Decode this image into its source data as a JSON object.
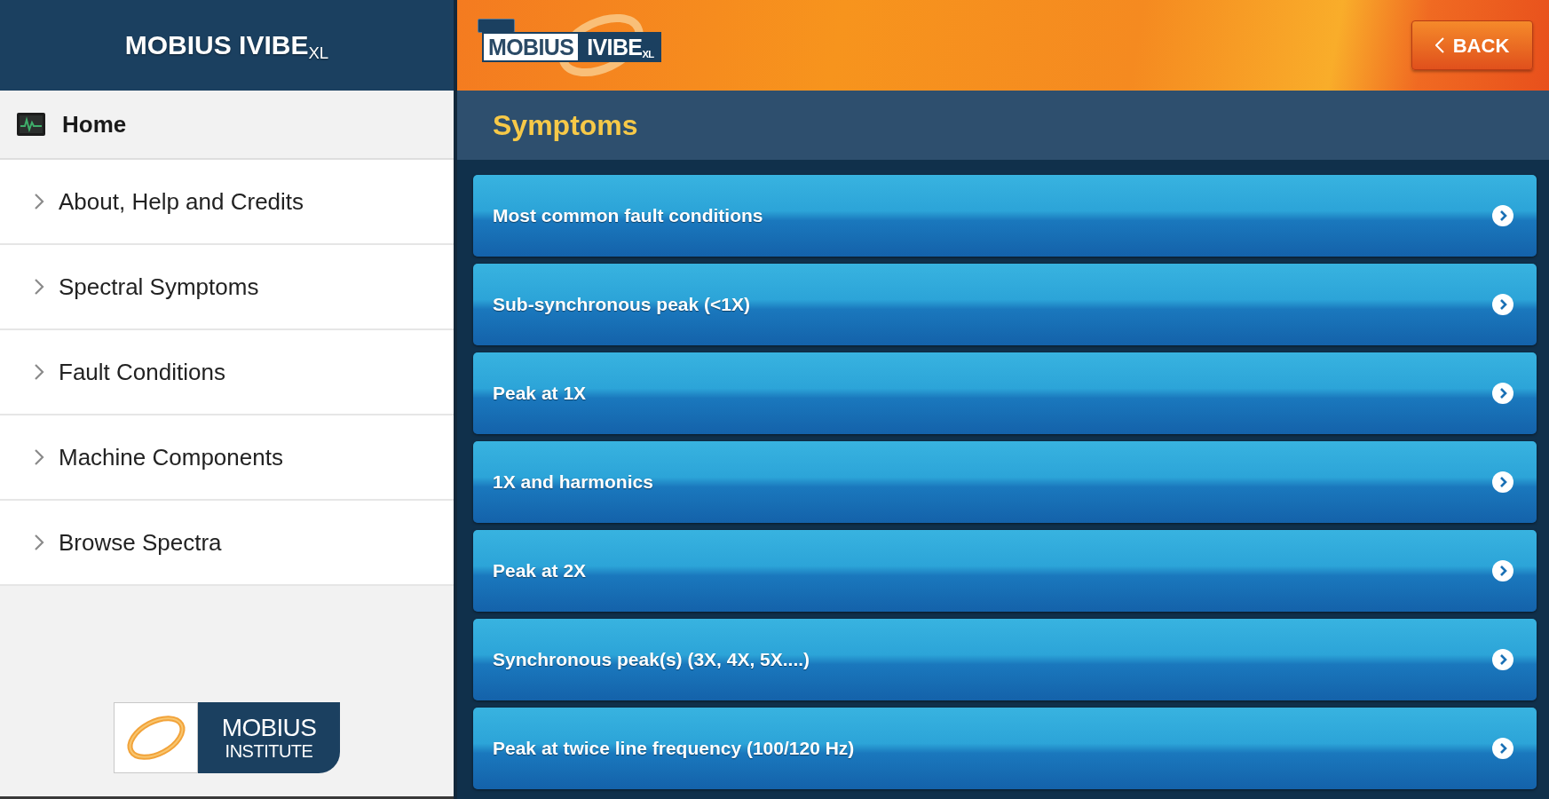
{
  "sidebar": {
    "header_title": "MOBIUS IVIBE$_{XL}$",
    "home": {
      "label": "Home"
    },
    "items": [
      {
        "label": "About, Help and Credits"
      },
      {
        "label": "Spectral Symptoms"
      },
      {
        "label": "Fault Conditions"
      },
      {
        "label": "Machine Components"
      },
      {
        "label": "Browse Spectra"
      }
    ],
    "footer_logo": {
      "line_1": "MOBIUS",
      "line_2": "INSTITUTE"
    }
  },
  "topbar": {
    "logo": {
      "word_1": "MOBIUS",
      "word_2": "IVIBE$_{XL}$"
    },
    "back_button": {
      "label": "BACK"
    }
  },
  "content": {
    "title": "Symptoms",
    "items": [
      {
        "label": "Most common fault conditions"
      },
      {
        "label": "Sub-synchronous peak (<1X)"
      },
      {
        "label": "Peak at 1X"
      },
      {
        "label": "1X and harmonics"
      },
      {
        "label": "Peak at 2X"
      },
      {
        "label": "Synchronous peak(s) (3X, 4X, 5X....)"
      },
      {
        "label": "Peak at twice line frequency (100/120 Hz)"
      }
    ]
  }
}
